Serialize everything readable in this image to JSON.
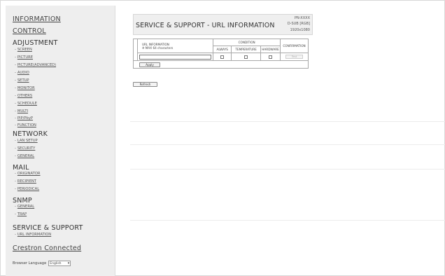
{
  "sidebar": {
    "information": "INFORMATION",
    "control": "CONTROL",
    "adjustment": {
      "label": "ADJUSTMENT",
      "items": [
        "SCREEN",
        "PICTURE",
        "PICTURE(ADVANCED)",
        "AUDIO",
        "SETUP",
        "MONITOR",
        "OTHERS",
        "SCHEDULE",
        "MULTI",
        "PIP/PbyP",
        "FUNCTION"
      ]
    },
    "network": {
      "label": "NETWORK",
      "items": [
        "LAN SETUP",
        "SECURITY",
        "GENERAL"
      ]
    },
    "mail": {
      "label": "MAIL",
      "items": [
        "ORIGINATOR",
        "RECIPIENT",
        "PERIODICAL"
      ]
    },
    "snmp": {
      "label": "SNMP",
      "items": [
        "GENERAL",
        "TRAP"
      ]
    },
    "service": {
      "label": "SERVICE & SUPPORT",
      "items": [
        "URL INFORMATION"
      ]
    },
    "crestron": "Crestron Connected",
    "browser_language_label": "Browser Language",
    "browser_language_value": "English"
  },
  "header": {
    "title": "SERVICE & SUPPORT - URL INFORMATION",
    "model": "PN-XXXX",
    "input": "D-SUB [RGB]",
    "resolution": "1920x1080"
  },
  "table": {
    "url_label": "URL INFORMATION",
    "url_hint": "※ MAX 64 characters",
    "condition_label": "CONDITION",
    "condition_columns": [
      "ALWAYS",
      "TEMPERATURE",
      "HARDWARE"
    ],
    "confirmation_label": "CONFIRMATION",
    "url_value": "",
    "test_label": "Test",
    "apply_label": "Apply"
  },
  "refresh_label": "Refresh",
  "colors": {
    "sidebar_bg": "#eeeeee",
    "title_bg": "#efefef",
    "border": "#a8a8a8"
  }
}
